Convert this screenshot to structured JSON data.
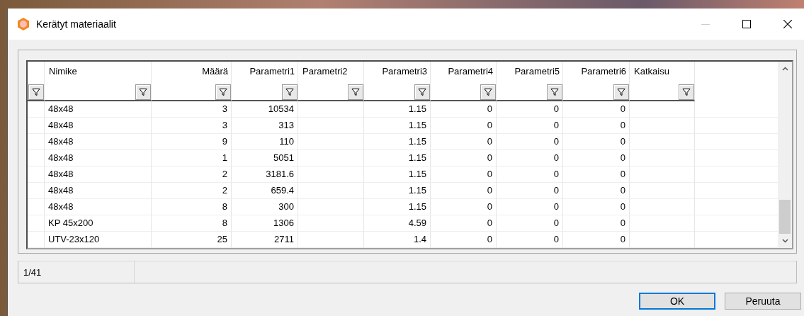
{
  "window": {
    "title": "Kerätyt materiaalit"
  },
  "table": {
    "columns": [
      {
        "label": "Nimike",
        "kind": "text"
      },
      {
        "label": "Määrä",
        "kind": "number"
      },
      {
        "label": "Parametri1",
        "kind": "number"
      },
      {
        "label": "Parametri2",
        "kind": "text"
      },
      {
        "label": "Parametri3",
        "kind": "number"
      },
      {
        "label": "Parametri4",
        "kind": "number"
      },
      {
        "label": "Parametri5",
        "kind": "number"
      },
      {
        "label": "Parametri6",
        "kind": "number"
      },
      {
        "label": "Katkaisu",
        "kind": "text"
      }
    ],
    "rows": [
      [
        "48x48",
        "3",
        "10534",
        "",
        "1.15",
        "0",
        "0",
        "0",
        ""
      ],
      [
        "48x48",
        "3",
        "313",
        "",
        "1.15",
        "0",
        "0",
        "0",
        ""
      ],
      [
        "48x48",
        "9",
        "110",
        "",
        "1.15",
        "0",
        "0",
        "0",
        ""
      ],
      [
        "48x48",
        "1",
        "5051",
        "",
        "1.15",
        "0",
        "0",
        "0",
        ""
      ],
      [
        "48x48",
        "2",
        "3181.6",
        "",
        "1.15",
        "0",
        "0",
        "0",
        ""
      ],
      [
        "48x48",
        "2",
        "659.4",
        "",
        "1.15",
        "0",
        "0",
        "0",
        ""
      ],
      [
        "48x48",
        "8",
        "300",
        "",
        "1.15",
        "0",
        "0",
        "0",
        ""
      ],
      [
        "KP 45x200",
        "8",
        "1306",
        "",
        "4.59",
        "0",
        "0",
        "0",
        ""
      ],
      [
        "UTV-23x120",
        "25",
        "2711",
        "",
        "1.4",
        "0",
        "0",
        "0",
        ""
      ]
    ]
  },
  "status_bar": {
    "record": "1/41"
  },
  "buttons": [
    {
      "label": "OK",
      "selected": true
    },
    {
      "label": "Peruuta",
      "selected": false
    }
  ]
}
